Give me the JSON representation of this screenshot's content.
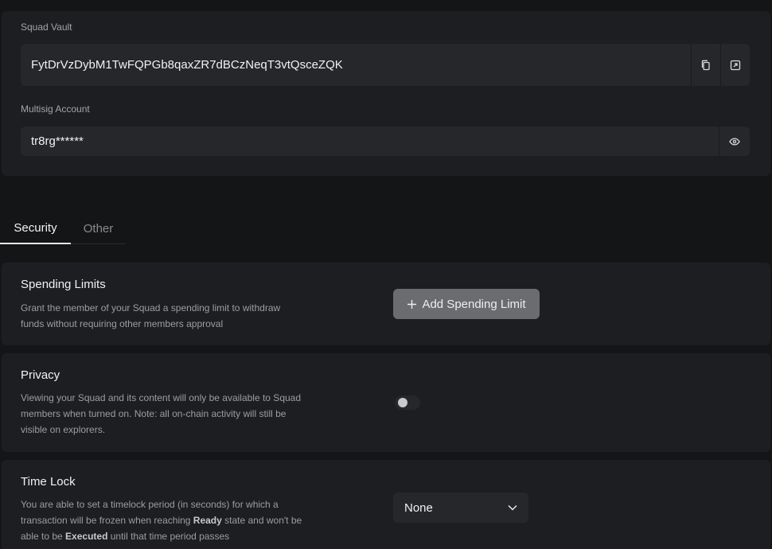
{
  "account": {
    "vault_label": "Squad Vault",
    "vault_address": "FytDrVzDybM1TwFQPGb8qaxZR7dBCzNeqT3vtQsceZQK",
    "multisig_label": "Multisig Account",
    "multisig_value": "tr8rg******"
  },
  "tabs": [
    {
      "label": "Security",
      "active": true
    },
    {
      "label": "Other",
      "active": false
    }
  ],
  "spending": {
    "title": "Spending Limits",
    "desc": "Grant the member of your Squad a spending limit to withdraw funds without requiring other members approval",
    "button": "Add Spending Limit"
  },
  "privacy": {
    "title": "Privacy",
    "desc": "Viewing your Squad and its content will only be available to Squad members when turned on. Note: all on-chain activity will still be visible on explorers.",
    "enabled": false
  },
  "timelock": {
    "title": "Time Lock",
    "desc_1": "You are able to set a timelock period (in seconds) for which a transaction will be frozen when reaching ",
    "desc_ready": "Ready",
    "desc_2": " state and won't be able to be ",
    "desc_executed": "Executed",
    "desc_3": " until that time period passes",
    "selected": "None"
  },
  "colors": {
    "page_bg": "#141517",
    "card_bg": "#1d1e21",
    "field_bg": "#26272b",
    "button_bg": "#6b6c70"
  }
}
